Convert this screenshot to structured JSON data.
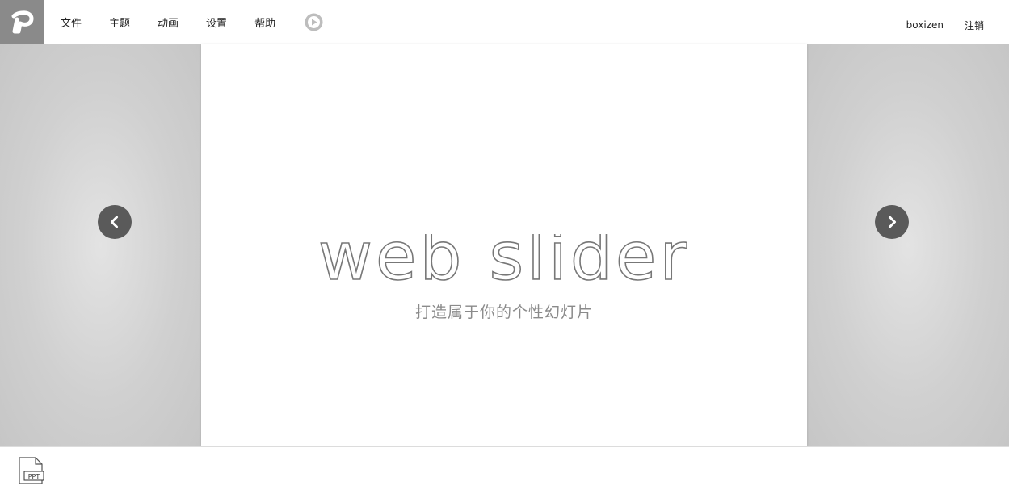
{
  "header": {
    "logo": "app-logo",
    "menu": [
      {
        "label": "文件"
      },
      {
        "label": "主题"
      },
      {
        "label": "动画"
      },
      {
        "label": "设置"
      },
      {
        "label": "帮助"
      }
    ],
    "play_icon": "play-icon",
    "username": "boxizen",
    "logout_label": "注销"
  },
  "slide": {
    "title": "web slider",
    "subtitle": "打造属于你的个性幻灯片"
  },
  "navigation": {
    "prev_icon": "chevron-left-icon",
    "next_icon": "chevron-right-icon"
  },
  "footer": {
    "file_type_label": "PPT"
  },
  "colors": {
    "logo_bg": "#8a8a8a",
    "stage_bg": "#d3d3d3",
    "arrow_bg": "#5a5a5a",
    "title_stroke": "#777777",
    "subtitle": "#8a8a8a"
  }
}
